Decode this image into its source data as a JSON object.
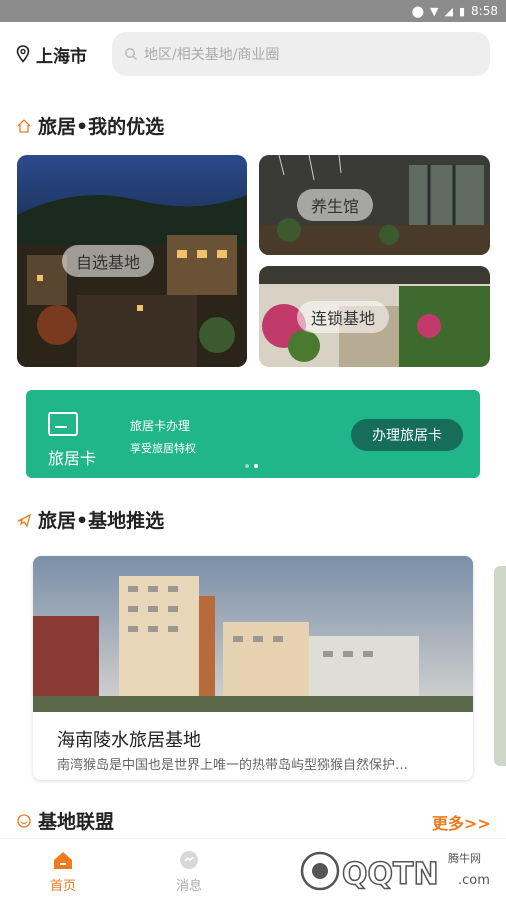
{
  "status_bar": {
    "time": "8:58"
  },
  "header": {
    "location": "上海市",
    "search_placeholder": "地区/相关基地/商业圈"
  },
  "sections": {
    "my_picks_title": "旅居•我的优选",
    "base_recommend_title": "旅居•基地推选",
    "alliance_title": "基地联盟",
    "more_label": "更多>>"
  },
  "tiles": {
    "self_select": "自选基地",
    "health_house": "养生馆",
    "chain_base": "连锁基地"
  },
  "travel_card": {
    "name": "旅居卡",
    "line1": "旅居卡办理",
    "line2": "享受旅居特权",
    "button": "办理旅居卡"
  },
  "base_card": {
    "name": "海南陵水旅居基地",
    "desc": "南湾猴岛是中国也是世界上唯一的热带岛屿型猕猴自然保护…"
  },
  "tabs": [
    {
      "label": "首页",
      "icon": "home-icon"
    },
    {
      "label": "消息",
      "icon": "message-icon"
    },
    {
      "label": "",
      "icon": "watermark-covered"
    },
    {
      "label": "",
      "icon": "watermark-covered"
    }
  ],
  "watermark": {
    "text": "QQTN.com",
    "subtext": "腾牛网"
  },
  "colors": {
    "accent": "#f07a1e",
    "card_green": "#20b68a",
    "card_button": "#166e5a"
  }
}
